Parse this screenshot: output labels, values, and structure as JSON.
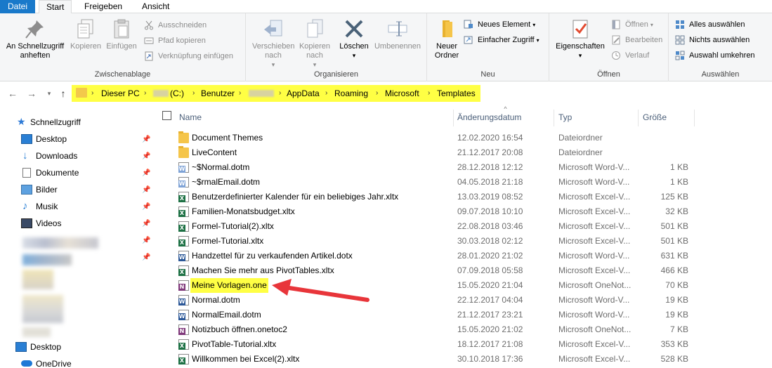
{
  "menu": {
    "tabs": [
      "Datei",
      "Start",
      "Freigeben",
      "Ansicht"
    ],
    "active_tab": "Start"
  },
  "ribbon": {
    "clipboard": {
      "label": "Zwischenablage",
      "pin_label": "An Schnellzugriff anheften",
      "copy_label": "Kopieren",
      "paste_label": "Einfügen",
      "cut_label": "Ausschneiden",
      "copy_path_label": "Pfad kopieren",
      "paste_shortcut_label": "Verknüpfung einfügen"
    },
    "organize": {
      "label": "Organisieren",
      "move_label": "Verschieben nach",
      "copyto_label": "Kopieren nach",
      "delete_label": "Löschen",
      "rename_label": "Umbenennen"
    },
    "new": {
      "label": "Neu",
      "folder_label": "Neuer Ordner",
      "new_item_label": "Neues Element",
      "easy_access_label": "Einfacher Zugriff"
    },
    "open": {
      "label": "Öffnen",
      "properties_label": "Eigenschaften",
      "open_label": "Öffnen",
      "edit_label": "Bearbeiten",
      "history_label": "Verlauf"
    },
    "select": {
      "label": "Auswählen",
      "select_all_label": "Alles auswählen",
      "select_none_label": "Nichts auswählen",
      "invert_label": "Auswahl umkehren"
    }
  },
  "address": {
    "crumbs": [
      "Dieser PC",
      "(C:)",
      "Benutzer",
      "AppData",
      "Roaming",
      "Microsoft",
      "Templates"
    ]
  },
  "navpane": {
    "quick_access": "Schnellzugriff",
    "items": [
      "Desktop",
      "Downloads",
      "Dokumente",
      "Bilder",
      "Musik",
      "Videos"
    ],
    "desktop": "Desktop",
    "onedrive": "OneDrive"
  },
  "columns": {
    "name": "Name",
    "date": "Änderungsdatum",
    "type": "Typ",
    "size": "Größe"
  },
  "files": [
    {
      "name": "Document Themes",
      "date": "12.02.2020 16:54",
      "type": "Dateiordner",
      "size": "",
      "kind": "folder"
    },
    {
      "name": "LiveContent",
      "date": "21.12.2017 20:08",
      "type": "Dateiordner",
      "size": "",
      "kind": "folder"
    },
    {
      "name": "~$Normal.dotm",
      "date": "28.12.2018 12:12",
      "type": "Microsoft Word-V...",
      "size": "1 KB",
      "kind": "word-light"
    },
    {
      "name": "~$rmalEmail.dotm",
      "date": "04.05.2018 21:18",
      "type": "Microsoft Word-V...",
      "size": "1 KB",
      "kind": "word-light"
    },
    {
      "name": "Benutzerdefinierter Kalender für ein beliebiges Jahr.xltx",
      "date": "13.03.2019 08:52",
      "type": "Microsoft Excel-V...",
      "size": "125 KB",
      "kind": "excel"
    },
    {
      "name": "Familien-Monatsbudget.xltx",
      "date": "09.07.2018 10:10",
      "type": "Microsoft Excel-V...",
      "size": "32 KB",
      "kind": "excel"
    },
    {
      "name": "Formel-Tutorial(2).xltx",
      "date": "22.08.2018 03:46",
      "type": "Microsoft Excel-V...",
      "size": "501 KB",
      "kind": "excel"
    },
    {
      "name": "Formel-Tutorial.xltx",
      "date": "30.03.2018 02:12",
      "type": "Microsoft Excel-V...",
      "size": "501 KB",
      "kind": "excel"
    },
    {
      "name": "Handzettel für zu verkaufenden Artikel.dotx",
      "date": "28.01.2020 21:02",
      "type": "Microsoft Word-V...",
      "size": "631 KB",
      "kind": "word"
    },
    {
      "name": "Machen Sie mehr aus PivotTables.xltx",
      "date": "07.09.2018 05:58",
      "type": "Microsoft Excel-V...",
      "size": "466 KB",
      "kind": "excel"
    },
    {
      "name": "Meine Vorlagen.one",
      "date": "15.05.2020 21:04",
      "type": "Microsoft OneNot...",
      "size": "70 KB",
      "kind": "onenote",
      "highlight": true
    },
    {
      "name": "Normal.dotm",
      "date": "22.12.2017 04:04",
      "type": "Microsoft Word-V...",
      "size": "19 KB",
      "kind": "word"
    },
    {
      "name": "NormalEmail.dotm",
      "date": "21.12.2017 23:21",
      "type": "Microsoft Word-V...",
      "size": "19 KB",
      "kind": "word"
    },
    {
      "name": "Notizbuch öffnen.onetoc2",
      "date": "15.05.2020 21:02",
      "type": "Microsoft OneNot...",
      "size": "7 KB",
      "kind": "onenote"
    },
    {
      "name": "PivotTable-Tutorial.xltx",
      "date": "18.12.2017 21:08",
      "type": "Microsoft Excel-V...",
      "size": "353 KB",
      "kind": "excel"
    },
    {
      "name": "Willkommen bei Excel(2).xltx",
      "date": "30.10.2018 17:36",
      "type": "Microsoft Excel-V...",
      "size": "528 KB",
      "kind": "excel"
    }
  ],
  "colors": {
    "file_tab": "#1979ca",
    "highlight": "#ffff44",
    "arrow": "#e8353a",
    "word": "#2b5797",
    "excel": "#1e7145",
    "onenote": "#80397b",
    "folder": "#f5c54a"
  },
  "icons": {
    "pin": "pin-icon",
    "copy": "copy-icon",
    "paste": "paste-icon",
    "cut": "scissors-icon",
    "delete": "x-icon",
    "rename": "rename-icon",
    "new_folder": "folder-icon",
    "properties": "properties-icon"
  }
}
